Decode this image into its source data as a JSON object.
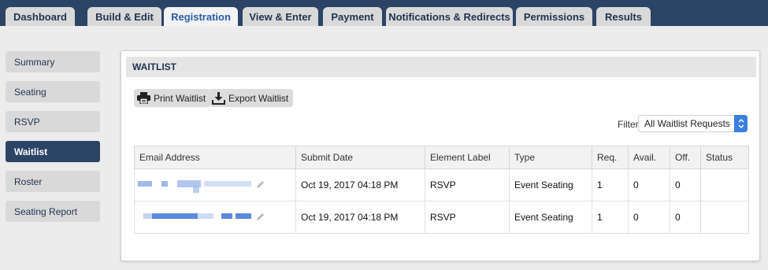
{
  "tabs": [
    {
      "label": "Dashboard"
    },
    {
      "label": "Build & Edit"
    },
    {
      "label": "Registration"
    },
    {
      "label": "View & Enter"
    },
    {
      "label": "Payment"
    },
    {
      "label": "Notifications & Redirects"
    },
    {
      "label": "Permissions"
    },
    {
      "label": "Results"
    }
  ],
  "active_tab": "Registration",
  "sidebar": {
    "items": [
      {
        "label": "Summary"
      },
      {
        "label": "Seating"
      },
      {
        "label": "RSVP"
      },
      {
        "label": "Waitlist"
      },
      {
        "label": "Roster"
      },
      {
        "label": "Seating Report"
      }
    ],
    "active": "Waitlist"
  },
  "panel": {
    "title": "WAITLIST",
    "print_label": "Print Waitlist",
    "export_label": "Export Waitlist",
    "filter_label": "Filter",
    "filter_value": "All Waitlist Requests"
  },
  "table": {
    "headers": [
      "Email Address",
      "Submit Date",
      "Element Label",
      "Type",
      "Req.",
      "Avail.",
      "Off.",
      "Status"
    ],
    "rows": [
      {
        "email": "",
        "submit_date": "Oct 19, 2017 04:18 PM",
        "element_label": "RSVP",
        "type": "Event Seating",
        "req": "1",
        "avail": "0",
        "off": "0",
        "status": ""
      },
      {
        "email": "",
        "submit_date": "Oct 19, 2017 04:18 PM",
        "element_label": "RSVP",
        "type": "Event Seating",
        "req": "1",
        "avail": "0",
        "off": "0",
        "status": ""
      }
    ]
  },
  "colors": {
    "nav_bg": "#2b4466",
    "active_tab_text": "#2a5fa8",
    "select_accent": "#3b7fe0"
  }
}
